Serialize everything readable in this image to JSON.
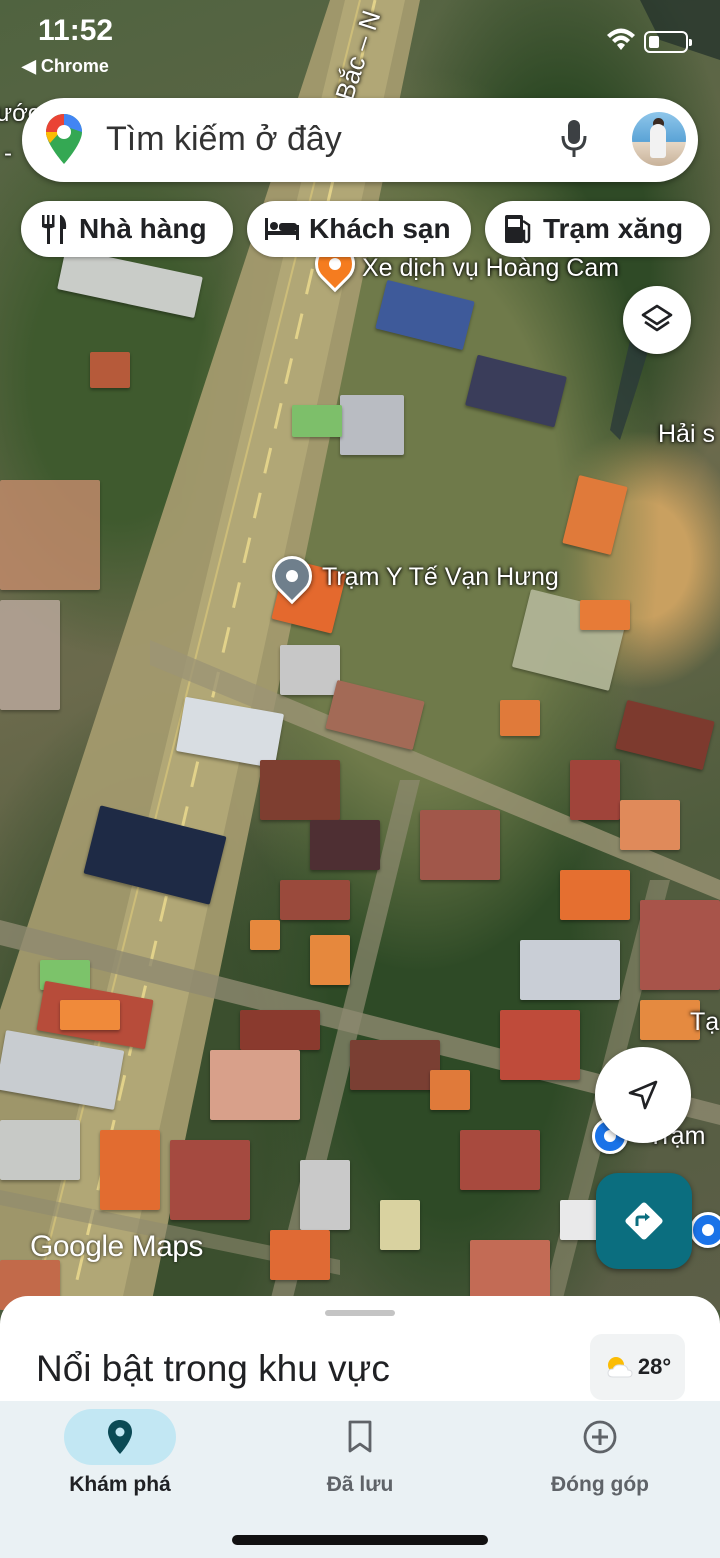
{
  "status_bar": {
    "time": "11:52",
    "back_app": "◀ Chrome"
  },
  "search": {
    "placeholder": "Tìm kiếm ở đây"
  },
  "chips": [
    {
      "label": "Nhà hàng",
      "icon": "restaurant-icon"
    },
    {
      "label": "Khách sạn",
      "icon": "hotel-icon"
    },
    {
      "label": "Trạm xăng",
      "icon": "gas-station-icon"
    }
  ],
  "map": {
    "road_label": "Bắc – N",
    "partial_label_left": "ước",
    "partial_label_left_2": "-",
    "pois": [
      {
        "name": "Xe dịch vụ Hoàng Cam",
        "color": "#f57c1f"
      },
      {
        "name": "Trạm Y Tế Vạn Hưng",
        "color": "#6f7f8c"
      },
      {
        "name": "Hải s",
        "color": ""
      },
      {
        "name": "Tạ",
        "color": ""
      },
      {
        "name": "Trạm",
        "color": "#1a73e8"
      }
    ],
    "watermark": "Google Maps"
  },
  "sheet": {
    "title": "Nổi bật trong khu vực",
    "weather": {
      "temp": "28°",
      "icon": "partly-cloudy-icon"
    }
  },
  "nav": [
    {
      "label": "Khám phá",
      "icon": "pin-icon",
      "active": true
    },
    {
      "label": "Đã lưu",
      "icon": "bookmark-icon",
      "active": false
    },
    {
      "label": "Đóng góp",
      "icon": "add-circle-icon",
      "active": false
    }
  ],
  "colors": {
    "accent": "#0b6e7f",
    "nav_active_pill": "#c2e7f3",
    "nav_bg": "#eaf1f4"
  }
}
